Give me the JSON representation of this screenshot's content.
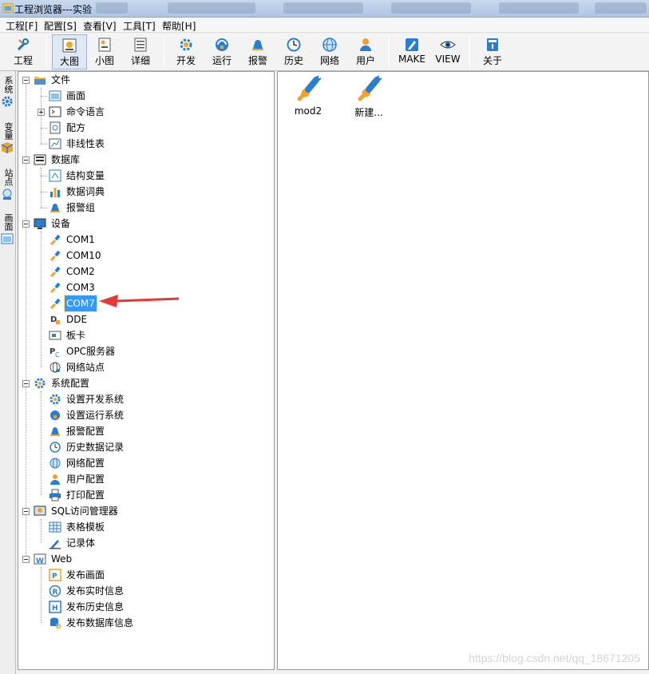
{
  "window": {
    "title": "工程浏览器---实验"
  },
  "menu": [
    "工程[F]",
    "配置[S]",
    "查看[V]",
    "工具[T]",
    "帮助[H]"
  ],
  "toolbar": [
    {
      "label": "工程",
      "icon": "wrench-icon"
    },
    {
      "label": "大图",
      "icon": "large-icons-icon",
      "active": true
    },
    {
      "label": "小图",
      "icon": "small-icons-icon"
    },
    {
      "label": "详细",
      "icon": "details-icon"
    },
    {
      "label": "开发",
      "icon": "develop-gear-icon"
    },
    {
      "label": "运行",
      "icon": "run-icon"
    },
    {
      "label": "报警",
      "icon": "alarm-bell-icon"
    },
    {
      "label": "历史",
      "icon": "history-clock-icon"
    },
    {
      "label": "网络",
      "icon": "network-globe-icon"
    },
    {
      "label": "用户",
      "icon": "user-icon"
    },
    {
      "label": "MAKE",
      "icon": "make-edit-icon"
    },
    {
      "label": "VIEW",
      "icon": "view-eye-icon"
    },
    {
      "label": "关于",
      "icon": "about-book-icon"
    }
  ],
  "side_tabs": [
    "系统",
    "变量",
    "站点",
    "画面"
  ],
  "tree": {
    "file": {
      "label": "文件",
      "children": [
        "画面",
        "命令语言",
        "配方",
        "非线性表"
      ]
    },
    "database": {
      "label": "数据库",
      "children": [
        "结构变量",
        "数据词典",
        "报警组"
      ]
    },
    "devices": {
      "label": "设备",
      "children": [
        "COM1",
        "COM10",
        "COM2",
        "COM3",
        "COM7",
        "DDE",
        "板卡",
        "OPC服务器",
        "网络站点"
      ],
      "selected": "COM7"
    },
    "sysconfig": {
      "label": "系统配置",
      "children": [
        "设置开发系统",
        "设置运行系统",
        "报警配置",
        "历史数据记录",
        "网络配置",
        "用户配置",
        "打印配置"
      ]
    },
    "sql": {
      "label": "SQL访问管理器",
      "children": [
        "表格模板",
        "记录体"
      ]
    },
    "web": {
      "label": "Web",
      "children": [
        "发布画面",
        "发布实时信息",
        "发布历史信息",
        "发布数据库信息"
      ]
    }
  },
  "content": {
    "items": [
      "mod2",
      "新建..."
    ]
  },
  "watermark": "https://blog.csdn.net/qq_18671205"
}
